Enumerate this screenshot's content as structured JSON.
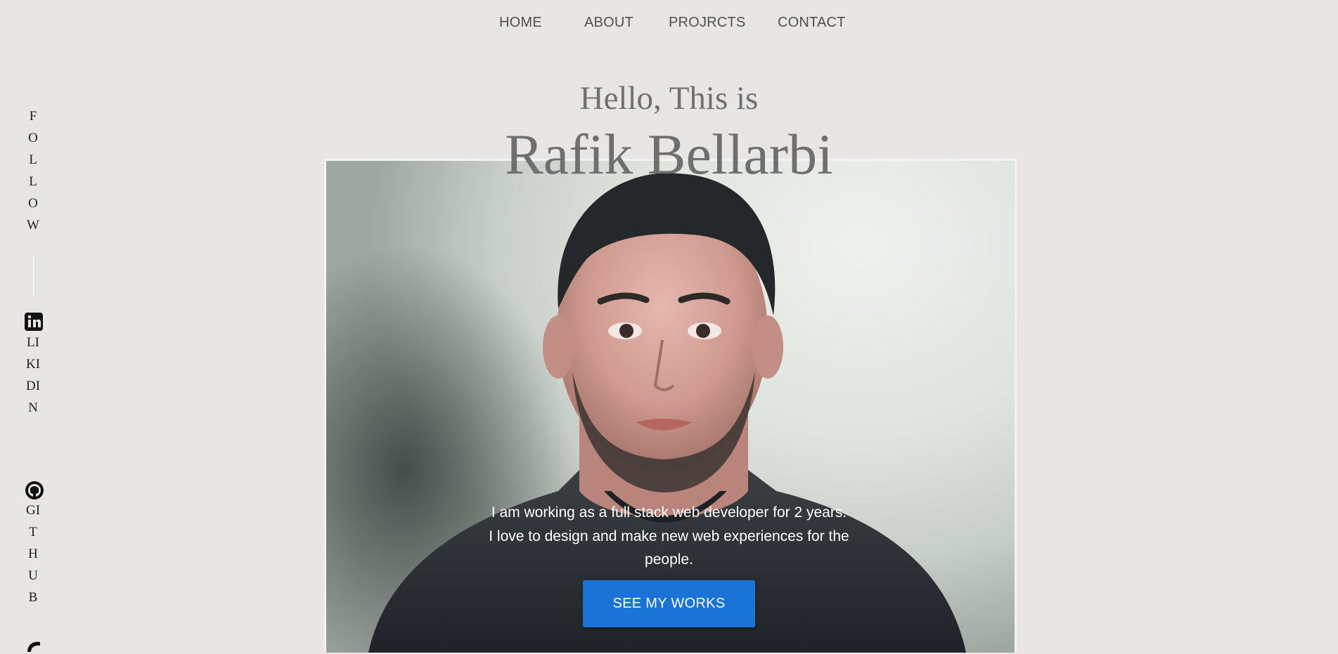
{
  "nav": {
    "items": [
      "HOME",
      "ABOUT",
      "PROJRCTS",
      "CONTACT"
    ]
  },
  "hero": {
    "greeting": "Hello, This is",
    "name": "Rafik Bellarbi",
    "intro_lines": [
      "I am working as a full stack web developer for 2 years.",
      "I love to design and make new web experiences for the",
      "people."
    ],
    "cta_label": "SEE MY WORKS"
  },
  "sidebar": {
    "follow_label": "FOLLOW",
    "linkedin_label": "LIKIDIN",
    "linkedin_icon": "linkedin-icon",
    "github_label": "GITHUB",
    "github_icon": "github-icon",
    "third_icon": "phone-icon"
  },
  "colors": {
    "background": "#e8e5e5",
    "accent": "#1a73d6",
    "text_muted": "#707070"
  }
}
